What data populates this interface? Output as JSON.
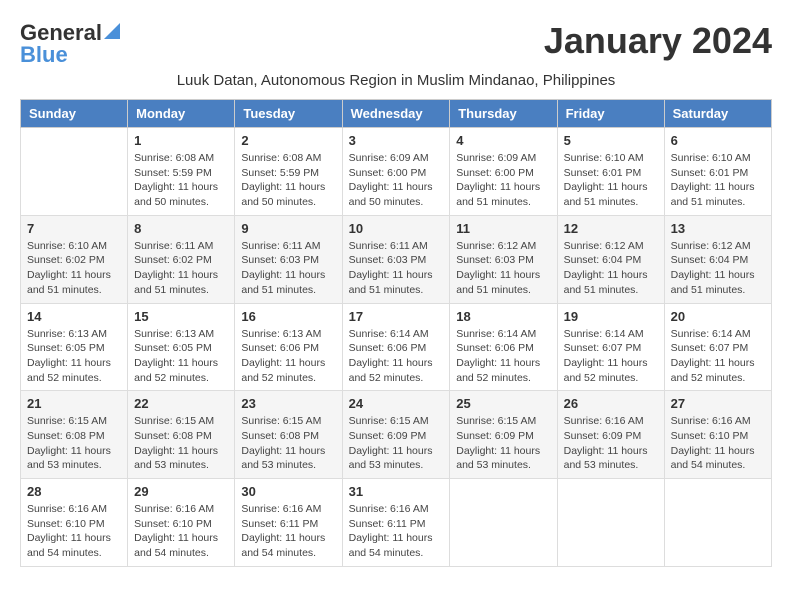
{
  "header": {
    "logo_general": "General",
    "logo_blue": "Blue",
    "month_title": "January 2024",
    "subtitle": "Luuk Datan, Autonomous Region in Muslim Mindanao, Philippines"
  },
  "days_of_week": [
    "Sunday",
    "Monday",
    "Tuesday",
    "Wednesday",
    "Thursday",
    "Friday",
    "Saturday"
  ],
  "weeks": [
    [
      {
        "day": "",
        "info": ""
      },
      {
        "day": "1",
        "info": "Sunrise: 6:08 AM\nSunset: 5:59 PM\nDaylight: 11 hours\nand 50 minutes."
      },
      {
        "day": "2",
        "info": "Sunrise: 6:08 AM\nSunset: 5:59 PM\nDaylight: 11 hours\nand 50 minutes."
      },
      {
        "day": "3",
        "info": "Sunrise: 6:09 AM\nSunset: 6:00 PM\nDaylight: 11 hours\nand 50 minutes."
      },
      {
        "day": "4",
        "info": "Sunrise: 6:09 AM\nSunset: 6:00 PM\nDaylight: 11 hours\nand 51 minutes."
      },
      {
        "day": "5",
        "info": "Sunrise: 6:10 AM\nSunset: 6:01 PM\nDaylight: 11 hours\nand 51 minutes."
      },
      {
        "day": "6",
        "info": "Sunrise: 6:10 AM\nSunset: 6:01 PM\nDaylight: 11 hours\nand 51 minutes."
      }
    ],
    [
      {
        "day": "7",
        "info": "Sunrise: 6:10 AM\nSunset: 6:02 PM\nDaylight: 11 hours\nand 51 minutes."
      },
      {
        "day": "8",
        "info": "Sunrise: 6:11 AM\nSunset: 6:02 PM\nDaylight: 11 hours\nand 51 minutes."
      },
      {
        "day": "9",
        "info": "Sunrise: 6:11 AM\nSunset: 6:03 PM\nDaylight: 11 hours\nand 51 minutes."
      },
      {
        "day": "10",
        "info": "Sunrise: 6:11 AM\nSunset: 6:03 PM\nDaylight: 11 hours\nand 51 minutes."
      },
      {
        "day": "11",
        "info": "Sunrise: 6:12 AM\nSunset: 6:03 PM\nDaylight: 11 hours\nand 51 minutes."
      },
      {
        "day": "12",
        "info": "Sunrise: 6:12 AM\nSunset: 6:04 PM\nDaylight: 11 hours\nand 51 minutes."
      },
      {
        "day": "13",
        "info": "Sunrise: 6:12 AM\nSunset: 6:04 PM\nDaylight: 11 hours\nand 51 minutes."
      }
    ],
    [
      {
        "day": "14",
        "info": "Sunrise: 6:13 AM\nSunset: 6:05 PM\nDaylight: 11 hours\nand 52 minutes."
      },
      {
        "day": "15",
        "info": "Sunrise: 6:13 AM\nSunset: 6:05 PM\nDaylight: 11 hours\nand 52 minutes."
      },
      {
        "day": "16",
        "info": "Sunrise: 6:13 AM\nSunset: 6:06 PM\nDaylight: 11 hours\nand 52 minutes."
      },
      {
        "day": "17",
        "info": "Sunrise: 6:14 AM\nSunset: 6:06 PM\nDaylight: 11 hours\nand 52 minutes."
      },
      {
        "day": "18",
        "info": "Sunrise: 6:14 AM\nSunset: 6:06 PM\nDaylight: 11 hours\nand 52 minutes."
      },
      {
        "day": "19",
        "info": "Sunrise: 6:14 AM\nSunset: 6:07 PM\nDaylight: 11 hours\nand 52 minutes."
      },
      {
        "day": "20",
        "info": "Sunrise: 6:14 AM\nSunset: 6:07 PM\nDaylight: 11 hours\nand 52 minutes."
      }
    ],
    [
      {
        "day": "21",
        "info": "Sunrise: 6:15 AM\nSunset: 6:08 PM\nDaylight: 11 hours\nand 53 minutes."
      },
      {
        "day": "22",
        "info": "Sunrise: 6:15 AM\nSunset: 6:08 PM\nDaylight: 11 hours\nand 53 minutes."
      },
      {
        "day": "23",
        "info": "Sunrise: 6:15 AM\nSunset: 6:08 PM\nDaylight: 11 hours\nand 53 minutes."
      },
      {
        "day": "24",
        "info": "Sunrise: 6:15 AM\nSunset: 6:09 PM\nDaylight: 11 hours\nand 53 minutes."
      },
      {
        "day": "25",
        "info": "Sunrise: 6:15 AM\nSunset: 6:09 PM\nDaylight: 11 hours\nand 53 minutes."
      },
      {
        "day": "26",
        "info": "Sunrise: 6:16 AM\nSunset: 6:09 PM\nDaylight: 11 hours\nand 53 minutes."
      },
      {
        "day": "27",
        "info": "Sunrise: 6:16 AM\nSunset: 6:10 PM\nDaylight: 11 hours\nand 54 minutes."
      }
    ],
    [
      {
        "day": "28",
        "info": "Sunrise: 6:16 AM\nSunset: 6:10 PM\nDaylight: 11 hours\nand 54 minutes."
      },
      {
        "day": "29",
        "info": "Sunrise: 6:16 AM\nSunset: 6:10 PM\nDaylight: 11 hours\nand 54 minutes."
      },
      {
        "day": "30",
        "info": "Sunrise: 6:16 AM\nSunset: 6:11 PM\nDaylight: 11 hours\nand 54 minutes."
      },
      {
        "day": "31",
        "info": "Sunrise: 6:16 AM\nSunset: 6:11 PM\nDaylight: 11 hours\nand 54 minutes."
      },
      {
        "day": "",
        "info": ""
      },
      {
        "day": "",
        "info": ""
      },
      {
        "day": "",
        "info": ""
      }
    ]
  ]
}
